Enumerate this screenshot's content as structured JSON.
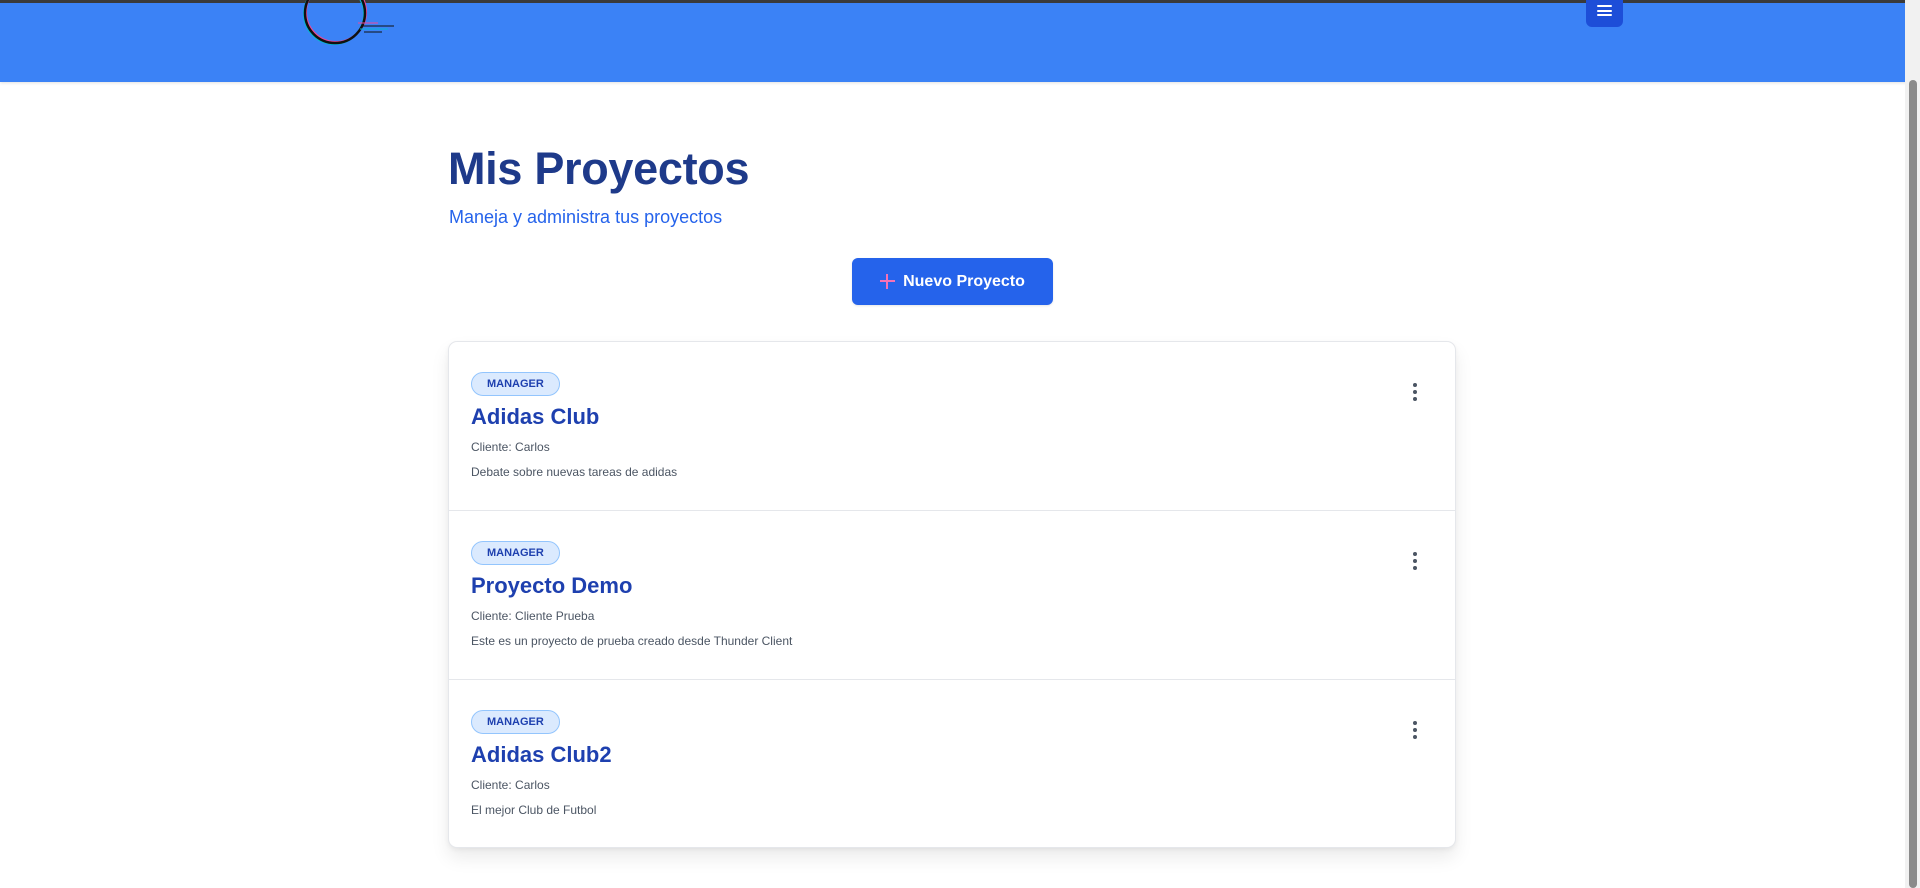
{
  "header": {
    "logo_icon": "circle-logo-icon",
    "menu_icon": "hamburger-menu-icon",
    "color": "#3b82f6"
  },
  "main": {
    "title": "Mis Proyectos",
    "subtitle": "Maneja y administra tus proyectos",
    "new_project_label": "Nuevo Proyecto",
    "new_project_icon": "plus-icon"
  },
  "projects": [
    {
      "role": "MANAGER",
      "name": "Adidas Club",
      "client": "Cliente: Carlos",
      "description": "Debate sobre nuevas tareas de adidas"
    },
    {
      "role": "MANAGER",
      "name": "Proyecto Demo",
      "client": "Cliente: Cliente Prueba",
      "description": "Este es un proyecto de prueba creado desde Thunder Client"
    },
    {
      "role": "MANAGER",
      "name": "Adidas Club2",
      "client": "Cliente: Carlos",
      "description": "El mejor Club de Futbol"
    }
  ],
  "colors": {
    "accent": "#2563eb",
    "title": "#1e3a8a",
    "badge_bg": "#dbeafe"
  }
}
